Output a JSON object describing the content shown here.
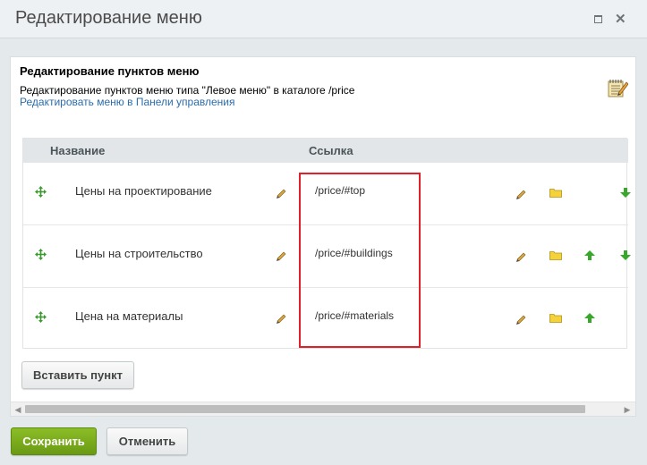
{
  "window": {
    "title": "Редактирование меню"
  },
  "header": {
    "title": "Редактирование пунктов меню",
    "subtitle": "Редактирование пунктов меню типа \"Левое меню\" в каталоге /price",
    "link": "Редактировать меню в Панели управления"
  },
  "table": {
    "columns": {
      "name": "Название",
      "link": "Ссылка"
    },
    "rows": [
      {
        "name": "Цены на проектирование",
        "link": "/price/#top",
        "can_move_up": false,
        "can_move_down": true
      },
      {
        "name": "Цены на строительство",
        "link": "/price/#buildings",
        "can_move_up": true,
        "can_move_down": true
      },
      {
        "name": "Цена на материалы",
        "link": "/price/#materials",
        "can_move_up": true,
        "can_move_down": false
      }
    ]
  },
  "buttons": {
    "insert": "Вставить пункт",
    "save": "Сохранить",
    "cancel": "Отменить"
  },
  "colors": {
    "accent_green": "#7aad1c",
    "link_blue": "#2c6dad",
    "highlight_red": "#e0212b"
  }
}
